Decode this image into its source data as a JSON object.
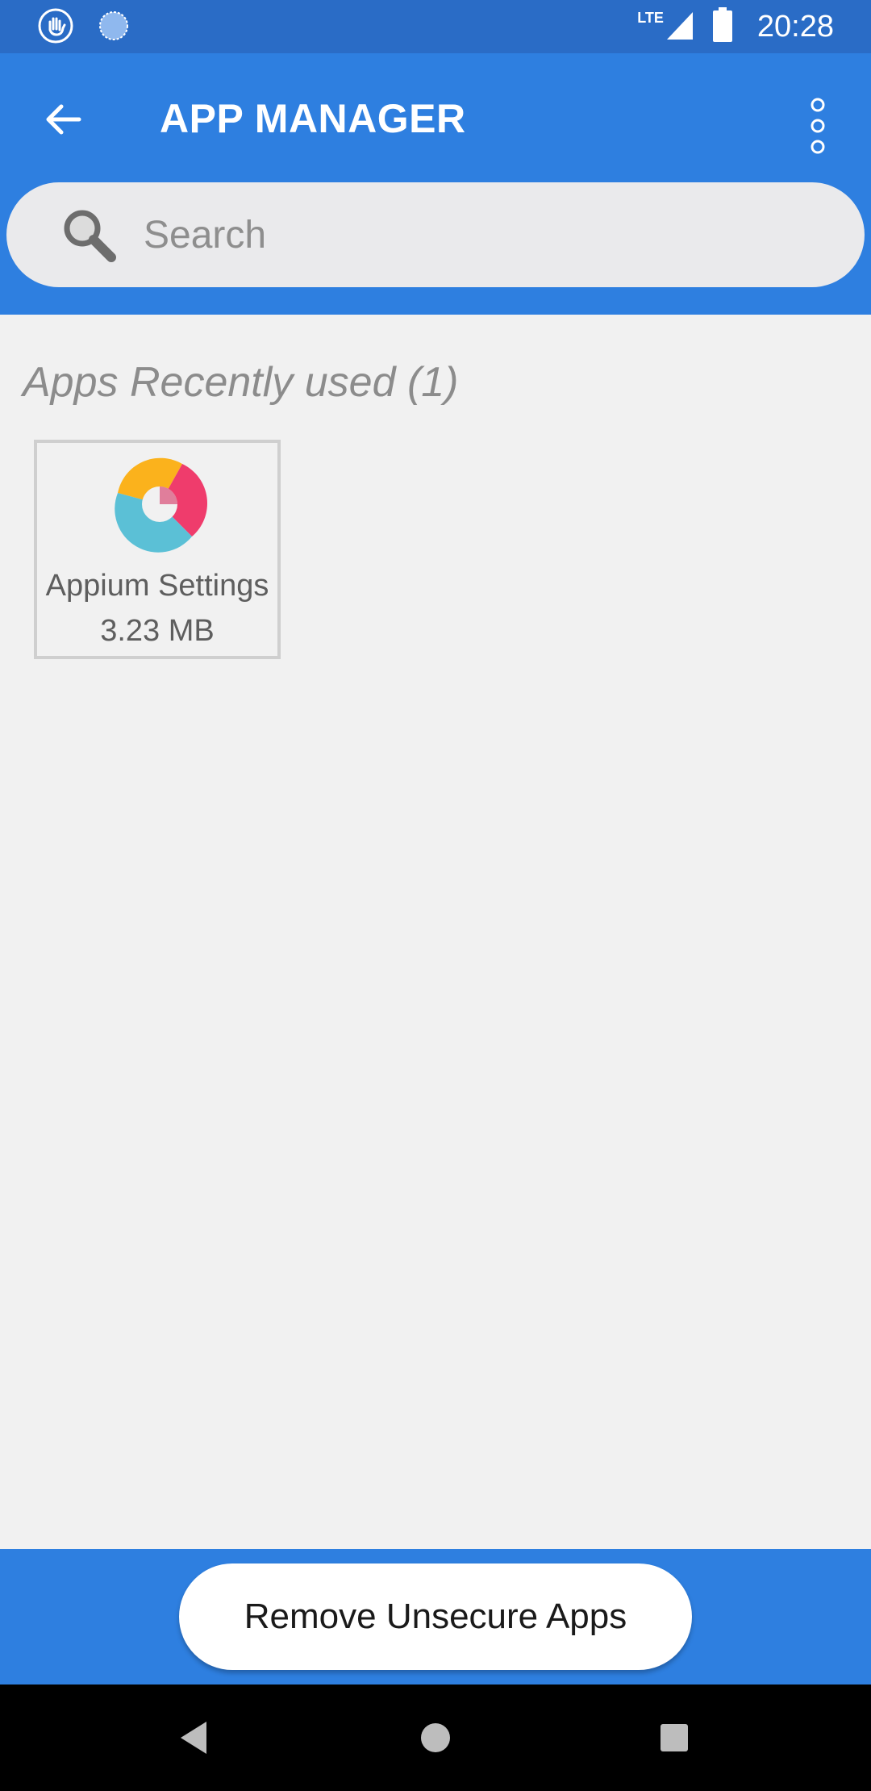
{
  "status_bar": {
    "time": "20:28",
    "network": "LTE",
    "icons": [
      "hand-icon",
      "sync-icon",
      "signal-icon",
      "battery-icon"
    ]
  },
  "app_bar": {
    "title": "APP MANAGER",
    "back_icon": "back-arrow-icon",
    "menu_icon": "more-vertical-icon"
  },
  "search": {
    "placeholder": "Search",
    "value": ""
  },
  "recent_section": {
    "title": "Apps Recently used (1)",
    "apps": [
      {
        "name": "Appium Settings",
        "size": "3.23 MB",
        "icon": "appium-logo-icon"
      }
    ]
  },
  "bottom": {
    "remove_button_label": "Remove Unsecure Apps"
  },
  "nav": {
    "icons": [
      "nav-back-icon",
      "nav-home-icon",
      "nav-recents-icon"
    ]
  },
  "colors": {
    "primary": "#2e7fe0",
    "status_bar": "#2a6cc6",
    "background": "#f1f1f1"
  }
}
